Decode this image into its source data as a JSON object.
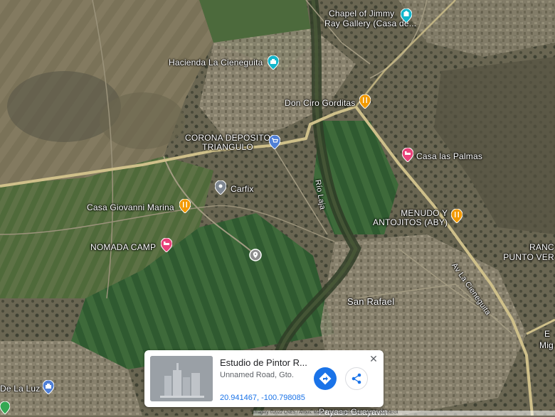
{
  "map_type": "satellite",
  "places": {
    "chapel": {
      "line1": "Chapel of Jimmy",
      "line2": "Ray Gallery (Casa de...",
      "icon": "museum-icon"
    },
    "hacienda": {
      "label": "Hacienda La Cieneguita",
      "icon": "landmark-icon"
    },
    "don_ciro": {
      "label": "Don Ciro Gorditas",
      "icon": "restaurant-icon"
    },
    "corona": {
      "line1": "CORONA DEPOSITO",
      "line2": "TRIANGULO",
      "icon": "shopping-icon"
    },
    "casa_palmas": {
      "label": "Casa las Palmas",
      "icon": "hotel-icon"
    },
    "carfix": {
      "label": "Carfix",
      "icon": "place-icon"
    },
    "casa_giovanni": {
      "label": "Casa Giovanni Marina",
      "icon": "restaurant-icon"
    },
    "menudo": {
      "line1": "MENUDO Y",
      "line2": "ANTOJITOS (ABY)",
      "icon": "restaurant-icon"
    },
    "nomada": {
      "label": "NOMADA CAMP",
      "icon": "hotel-icon"
    },
    "ranch": {
      "line1": "RANC",
      "line2": "PUNTO VER"
    },
    "san_rafael": {
      "label": "San Rafael"
    },
    "de_la_luz": {
      "label": "De La Luz",
      "icon": "landmark-icon"
    },
    "edge_e": {
      "label": "E"
    },
    "edge_mig": {
      "label": "Mig"
    },
    "payaso": {
      "label": "Payaso Guayavin"
    }
  },
  "roads": {
    "rio_laja": "Río Laja",
    "av_cieneguita": "Av La Cieneguita"
  },
  "info_card": {
    "title": "Estudio de Pintor R...",
    "subtitle": "Unnamed Road, Gto.",
    "coordinates": "20.941467, -100.798085"
  },
  "attribution": "Imagery ©2022 CNES / Airbus, Maxar Technologies, Map data ©2022 INEGI",
  "colors": {
    "road": "#d9c98c",
    "pin_orange": "#f29900",
    "pin_blue": "#4f7fd6",
    "pin_teal": "#12b5cb",
    "pin_pink": "#e8437a",
    "pin_gray": "#7f8792",
    "accent_blue": "#1a73e8"
  }
}
